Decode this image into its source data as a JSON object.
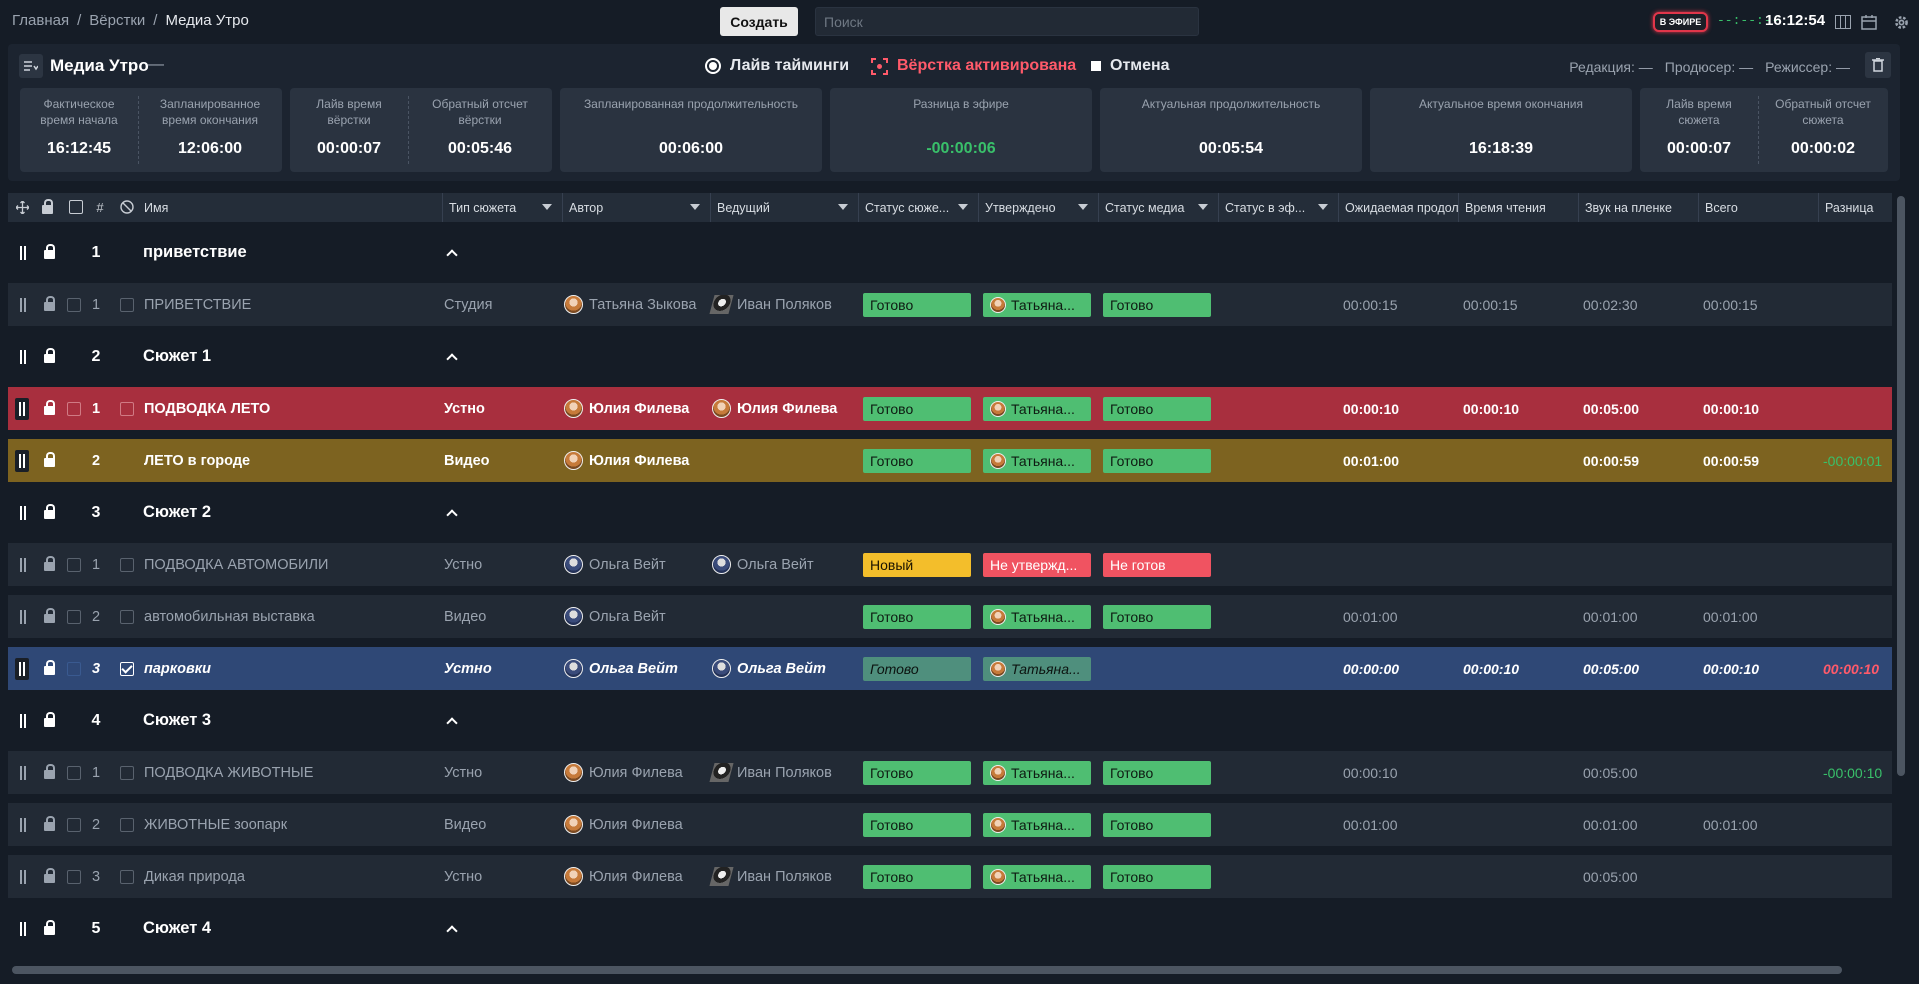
{
  "breadcrumb": {
    "home": "Главная",
    "rundowns": "Вёрстки",
    "current": "Медиа Утро",
    "sep": "/"
  },
  "toolbar": {
    "create_label": "Создать",
    "search_placeholder": "Поиск",
    "onair_label": "В ЭФИРЕ",
    "timer_dashes": "--:--:--",
    "clock": "16:12:54"
  },
  "rundown": {
    "title": "Медиа Утро",
    "title_dash": "—",
    "live_timing_label": "Лайв тайминги",
    "activated_label": "Вёрстка активирована",
    "cancel_label": "Отмена",
    "editor": "Редакция: —",
    "producer": "Продюсер: —",
    "director": "Режиссер: —"
  },
  "stats": {
    "actual_start": {
      "label": "Фактическое время начала",
      "value": "16:12:45"
    },
    "planned_end": {
      "label": "Запланированное время окончания",
      "value": "12:06:00"
    },
    "live_rundown": {
      "label": "Лайв время вёрстки",
      "value": "00:00:07"
    },
    "countdown_rundown": {
      "label": "Обратный отсчет вёрстки",
      "value": "00:05:46"
    },
    "planned_duration": {
      "label": "Запланированная продолжительность",
      "value": "00:06:00"
    },
    "onair_diff": {
      "label": "Разница в эфире",
      "value": "-00:00:06"
    },
    "actual_duration": {
      "label": "Актуальная продолжительность",
      "value": "00:05:54"
    },
    "actual_end": {
      "label": "Актуальное время окончания",
      "value": "16:18:39"
    },
    "live_story": {
      "label": "Лайв время сюжета",
      "value": "00:00:07"
    },
    "countdown_story": {
      "label": "Обратный отсчет сюжета",
      "value": "00:00:02"
    }
  },
  "columns": {
    "num": "#",
    "name": "Имя",
    "type": "Тип сюжета",
    "author": "Автор",
    "host": "Ведущий",
    "story_status": "Статус сюже...",
    "approved": "Утверждено",
    "media_status": "Статус медиа",
    "air_status": "Статус в эф...",
    "expected": "Ожидаемая продол",
    "read_time": "Время чтения",
    "tape_sound": "Звук на пленке",
    "total": "Всего",
    "diff": "Разница"
  },
  "rows": [
    {
      "kind": "group",
      "num": "1",
      "name": "приветствие"
    },
    {
      "kind": "story",
      "num": "1",
      "name": "ПРИВЕТСТВИЕ",
      "type": "Студия",
      "author": "Татьяна Зыкова",
      "host": "Иван Поляков",
      "story_status": "Готово",
      "approved": "Татьяна...",
      "media_status": "Готово",
      "expected": "00:00:15",
      "read_time": "00:00:15",
      "tape_sound": "00:02:30",
      "total": "00:00:15",
      "diff": ""
    },
    {
      "kind": "group",
      "num": "2",
      "name": "Сюжет 1"
    },
    {
      "kind": "story",
      "num": "1",
      "name": "ПОДВОДКА ЛЕТО",
      "type": "Устно",
      "author": "Юлия Филева",
      "host": "Юлия Филева",
      "story_status": "Готово",
      "approved": "Татьяна...",
      "media_status": "Готово",
      "expected": "00:00:10",
      "read_time": "00:00:10",
      "tape_sound": "00:05:00",
      "total": "00:00:10",
      "diff": ""
    },
    {
      "kind": "story",
      "num": "2",
      "name": "ЛЕТО в городе",
      "type": "Видео",
      "author": "Юлия Филева",
      "host": "",
      "story_status": "Готово",
      "approved": "Татьяна...",
      "media_status": "Готово",
      "expected": "00:01:00",
      "read_time": "",
      "tape_sound": "00:00:59",
      "total": "00:00:59",
      "diff": "-00:00:01"
    },
    {
      "kind": "group",
      "num": "3",
      "name": "Сюжет 2"
    },
    {
      "kind": "story",
      "num": "1",
      "name": "ПОДВОДКА АВТОМОБИЛИ",
      "type": "Устно",
      "author": "Ольга Вейт",
      "host": "Ольга Вейт",
      "story_status": "Новый",
      "approved": "Не утвержд...",
      "media_status": "Не готов",
      "expected": "",
      "read_time": "",
      "tape_sound": "",
      "total": "",
      "diff": ""
    },
    {
      "kind": "story",
      "num": "2",
      "name": "автомобильная выставка",
      "type": "Видео",
      "author": "Ольга Вейт",
      "host": "",
      "story_status": "Готово",
      "approved": "Татьяна...",
      "media_status": "Готово",
      "expected": "00:01:00",
      "read_time": "",
      "tape_sound": "00:01:00",
      "total": "00:01:00",
      "diff": ""
    },
    {
      "kind": "story",
      "num": "3",
      "name": "парковки",
      "type": "Устно",
      "author": "Ольга Вейт",
      "host": "Ольга Вейт",
      "story_status": "Готово",
      "approved": "Татьяна...",
      "media_status": "",
      "expected": "00:00:00",
      "read_time": "00:00:10",
      "tape_sound": "00:05:00",
      "total": "00:00:10",
      "diff": "00:00:10"
    },
    {
      "kind": "group",
      "num": "4",
      "name": "Сюжет 3"
    },
    {
      "kind": "story",
      "num": "1",
      "name": "ПОДВОДКА ЖИВОТНЫЕ",
      "type": "Устно",
      "author": "Юлия Филева",
      "host": "Иван Поляков",
      "story_status": "Готово",
      "approved": "Татьяна...",
      "media_status": "Готово",
      "expected": "00:00:10",
      "read_time": "",
      "tape_sound": "00:05:00",
      "total": "",
      "diff": "-00:00:10"
    },
    {
      "kind": "story",
      "num": "2",
      "name": "ЖИВОТНЫЕ зоопарк",
      "type": "Видео",
      "author": "Юлия Филева",
      "host": "",
      "story_status": "Готово",
      "approved": "Татьяна...",
      "media_status": "Готово",
      "expected": "00:01:00",
      "read_time": "",
      "tape_sound": "00:01:00",
      "total": "00:01:00",
      "diff": ""
    },
    {
      "kind": "story",
      "num": "3",
      "name": "Дикая природа",
      "type": "Устно",
      "author": "Юлия Филева",
      "host": "Иван Поляков",
      "story_status": "Готово",
      "approved": "Татьяна...",
      "media_status": "Готово",
      "expected": "",
      "read_time": "",
      "tape_sound": "00:05:00",
      "total": "",
      "diff": ""
    },
    {
      "kind": "group",
      "num": "5",
      "name": "Сюжет 4"
    }
  ],
  "colors": {
    "accent_red": "#a82f3e",
    "accent_yellow": "#7d6320",
    "selected_blue": "#2f4876",
    "ready_green": "#4fbe72",
    "new_yellow": "#f3be2b",
    "not_ready_red": "#f05361"
  }
}
